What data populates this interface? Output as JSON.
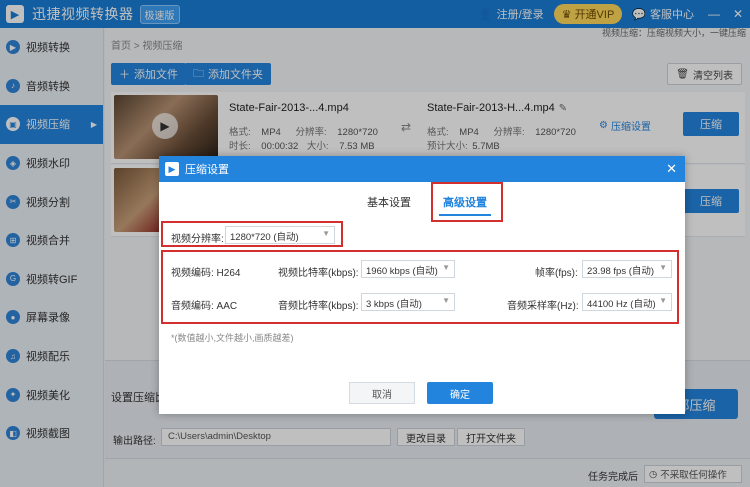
{
  "titlebar": {
    "app_title": "迅捷视频转换器",
    "speed_badge": "极速版",
    "login": "注册/登录",
    "vip": "开通VIP",
    "feedback": "客服中心",
    "minimize": "—",
    "close": "✕"
  },
  "sidebar": {
    "items": [
      {
        "label": "视频转换"
      },
      {
        "label": "音频转换"
      },
      {
        "label": "视频压缩"
      },
      {
        "label": "视频水印"
      },
      {
        "label": "视频分割"
      },
      {
        "label": "视频合并"
      },
      {
        "label": "视频转GIF"
      },
      {
        "label": "屏幕录像"
      },
      {
        "label": "视频配乐"
      },
      {
        "label": "视频美化"
      },
      {
        "label": "视频截图"
      }
    ]
  },
  "main": {
    "breadcrumb": "首页 > 视频压缩",
    "hint_top": "视频压缩：压缩视频大小，一键压缩",
    "add_file": "添加文件",
    "add_folder": "添加文件夹",
    "clear_list": "清空列表",
    "files": [
      {
        "src_name": "State-Fair-2013-...4.mp4",
        "src_format_label": "格式:",
        "src_format": "MP4",
        "src_res_label": "分辨率:",
        "src_res": "1280*720",
        "src_duration_label": "时长:",
        "src_duration": "00:00:32",
        "src_size_label": "大小:",
        "src_size": "7.53 MB",
        "dst_name": "State-Fair-2013-H...4.mp4",
        "dst_format_label": "格式:",
        "dst_format": "MP4",
        "dst_res_label": "分辨率:",
        "dst_res": "1280*720",
        "dst_size_label": "预计大小:",
        "dst_size": "5.7MB",
        "settings": "压缩设置",
        "compress": "压缩"
      },
      {
        "compress": "压缩"
      }
    ],
    "set_compress": "设置压缩比",
    "all_compress": "部压缩",
    "output_label": "输出路径:",
    "output_path": "C:\\Users\\admin\\Desktop",
    "change_dir": "更改目录",
    "open_folder": "打开文件夹",
    "task_done_label": "任务完成后",
    "task_done_value": "不采取任何操作"
  },
  "dialog": {
    "title": "压缩设置",
    "close": "✕",
    "tab_basic": "基本设置",
    "tab_advanced": "高级设置",
    "resolution_label": "视频分辨率:",
    "resolution_value": "1280*720 (自动)",
    "video_codec": "视频编码: H264",
    "video_bitrate_label": "视频比特率(kbps):",
    "video_bitrate_value": "1960 kbps (自动)",
    "fps_label": "帧率(fps):",
    "fps_value": "23.98 fps (自动)",
    "audio_codec": "音频编码: AAC",
    "audio_bitrate_label": "音频比特率(kbps):",
    "audio_bitrate_value": "3 kbps (自动)",
    "sample_rate_label": "音频采样率(Hz):",
    "sample_rate_value": "44100 Hz (自动)",
    "note": "*(数值越小,文件越小,画质越差)",
    "cancel": "取消",
    "ok": "确定"
  },
  "colors": {
    "primary": "#2384de",
    "highlight_box": "#d32f2f",
    "vip": "#ffd95a"
  }
}
